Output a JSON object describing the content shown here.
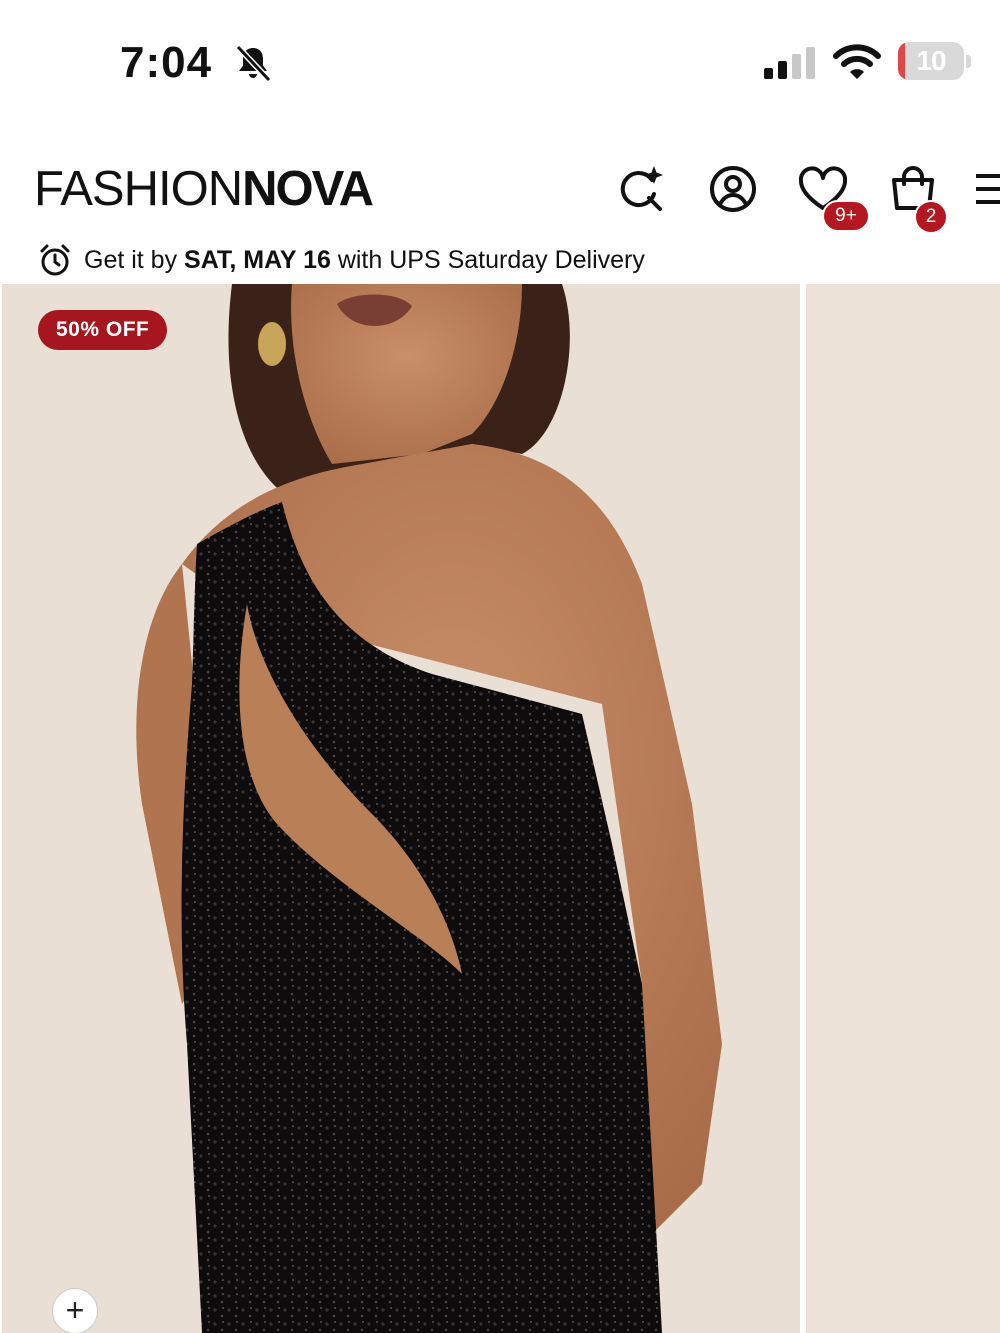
{
  "status_bar": {
    "time": "7:04",
    "battery_level": "10",
    "battery_color": "#e04848"
  },
  "header": {
    "logo_light": "FASHION",
    "logo_bold": "NOVA",
    "icons": [
      "ai-search-icon",
      "account-icon",
      "wishlist-icon",
      "cart-icon",
      "menu-icon"
    ],
    "wishlist_count": "9+",
    "cart_count": "2",
    "badge_color": "#b5161f"
  },
  "delivery": {
    "prefix": "Get it by",
    "date": "SAT, MAY 16",
    "suffix": "with UPS Saturday Delivery"
  },
  "product": {
    "discount_label": "50% OFF",
    "add_symbol": "+",
    "image_description": "Model wearing black sequin one-shoulder cutout dress"
  }
}
